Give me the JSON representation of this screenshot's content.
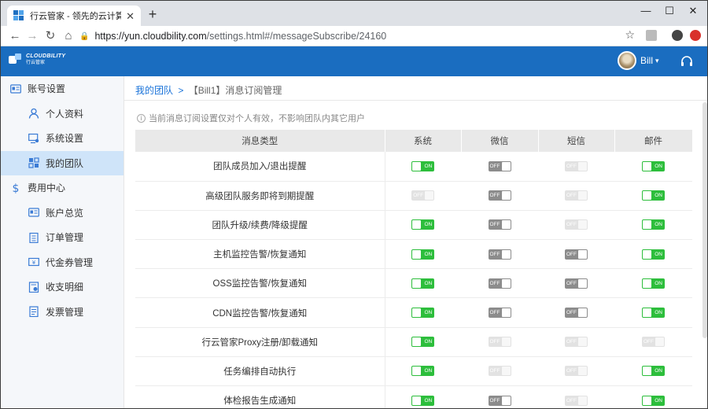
{
  "browser": {
    "tab_title": "行云管家 - 领先的云计算管理平台",
    "url_host": "https://yun.cloudbility.com",
    "url_path": "/settings.html#/messageSubscribe/24160"
  },
  "app": {
    "logo_text": "CLOUDBILITY",
    "logo_sub": "行云管家",
    "user_name": "Bill"
  },
  "sidebar": {
    "items": [
      {
        "label": "账号设置",
        "level": "top",
        "icon": "account-card-icon"
      },
      {
        "label": "个人资料",
        "level": "sub",
        "icon": "user-icon"
      },
      {
        "label": "系统设置",
        "level": "sub",
        "icon": "monitor-gear-icon"
      },
      {
        "label": "我的团队",
        "level": "sub",
        "icon": "team-grid-icon",
        "active": true
      },
      {
        "label": "费用中心",
        "level": "top",
        "icon": "dollar-icon"
      },
      {
        "label": "账户总览",
        "level": "sub",
        "icon": "account-card-icon"
      },
      {
        "label": "订单管理",
        "level": "sub",
        "icon": "clipboard-icon"
      },
      {
        "label": "代金券管理",
        "level": "sub",
        "icon": "voucher-icon"
      },
      {
        "label": "收支明细",
        "level": "sub",
        "icon": "ledger-icon"
      },
      {
        "label": "发票管理",
        "level": "sub",
        "icon": "invoice-icon"
      }
    ]
  },
  "breadcrumb": {
    "link": "我的团队",
    "separator": ">",
    "current": "【Bill1】消息订阅管理"
  },
  "notice": "当前消息订阅设置仅对个人有效，不影响团队内其它用户",
  "table": {
    "headers": [
      "消息类型",
      "系统",
      "微信",
      "短信",
      "邮件"
    ],
    "state_labels": {
      "on": "ON",
      "off": "OFF"
    },
    "rows": [
      {
        "name": "团队成员加入/退出提醒",
        "states": [
          "on",
          "off",
          "dis",
          "on"
        ]
      },
      {
        "name": "高级团队服务即将到期提醒",
        "states": [
          "dis",
          "off",
          "dis",
          "on"
        ]
      },
      {
        "name": "团队升级/续费/降级提醒",
        "states": [
          "on",
          "off",
          "dis",
          "on"
        ]
      },
      {
        "name": "主机监控告警/恢复通知",
        "states": [
          "on",
          "off",
          "off",
          "on"
        ]
      },
      {
        "name": "OSS监控告警/恢复通知",
        "states": [
          "on",
          "off",
          "off",
          "on"
        ]
      },
      {
        "name": "CDN监控告警/恢复通知",
        "states": [
          "on",
          "off",
          "off",
          "on"
        ]
      },
      {
        "name": "行云管家Proxy注册/卸载通知",
        "states": [
          "on",
          "dis",
          "dis",
          "dis"
        ]
      },
      {
        "name": "任务编排自动执行",
        "states": [
          "on",
          "dis",
          "dis",
          "on"
        ]
      },
      {
        "name": "体检报告生成通知",
        "states": [
          "on",
          "off",
          "dis",
          "on"
        ]
      }
    ]
  },
  "colors": {
    "brand": "#1a6dc0",
    "toggle_on": "#2dbe3c",
    "toggle_off": "#8c8c8c",
    "toggle_disabled": "#e2e2e2",
    "active_nav": "#cfe4f9"
  }
}
